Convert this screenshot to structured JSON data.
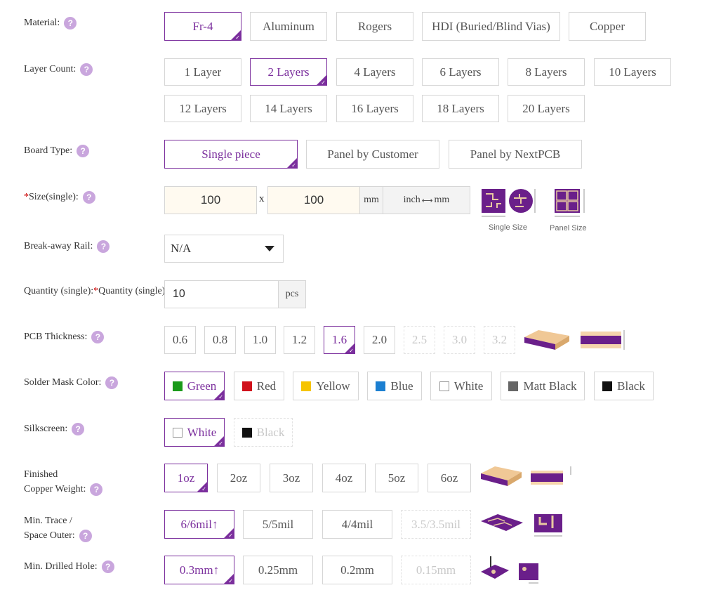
{
  "material": {
    "label": "Material:",
    "options": [
      "Fr-4",
      "Aluminum",
      "Rogers",
      "HDI (Buried/Blind Vias)",
      "Copper"
    ]
  },
  "layer_count": {
    "label": "Layer Count:",
    "options": [
      "1 Layer",
      "2 Layers",
      "4 Layers",
      "6 Layers",
      "8 Layers",
      "10 Layers",
      "12 Layers",
      "14 Layers",
      "16 Layers",
      "18 Layers",
      "20 Layers"
    ]
  },
  "board_type": {
    "label": "Board Type:",
    "options": [
      "Single piece",
      "Panel by Customer",
      "Panel by NextPCB"
    ]
  },
  "size": {
    "label": "*Size(single):",
    "width": "100",
    "height": "100",
    "x": "x",
    "unit": "mm",
    "toggle_left": "inch",
    "toggle_right": "mm",
    "single_caption": "Single Size",
    "panel_caption": "Panel Size"
  },
  "breakaway": {
    "label": "Break-away Rail:",
    "value": "N/A"
  },
  "quantity": {
    "label": "*Quantity (single):",
    "value": "10",
    "unit": "pcs"
  },
  "thickness": {
    "label": "PCB Thickness:",
    "options": [
      "0.6",
      "0.8",
      "1.0",
      "1.2",
      "1.6",
      "2.0",
      "2.5",
      "3.0",
      "3.2"
    ]
  },
  "solder_mask": {
    "label": "Solder Mask Color:",
    "options": [
      "Green",
      "Red",
      "Yellow",
      "Blue",
      "White",
      "Matt Black",
      "Black"
    ],
    "colors": [
      "#1a9a1a",
      "#d0111b",
      "#f6c400",
      "#1b7fd1",
      "#ffffff",
      "#666666",
      "#111111"
    ]
  },
  "silkscreen": {
    "label": "Silkscreen:",
    "options": [
      "White",
      "Black"
    ]
  },
  "copper_weight": {
    "label_line1": "Finished",
    "label_line2": "Copper Weight:",
    "options": [
      "1oz",
      "2oz",
      "3oz",
      "4oz",
      "5oz",
      "6oz"
    ]
  },
  "trace": {
    "label_line1": "Min. Trace /",
    "label_line2": "Space Outer:",
    "options": [
      "6/6mil↑",
      "5/5mil",
      "4/4mil",
      "3.5/3.5mil"
    ]
  },
  "drill": {
    "label": "Min. Drilled Hole:",
    "options": [
      "0.3mm↑",
      "0.25mm",
      "0.2mm",
      "0.15mm"
    ]
  },
  "help_icon": "?"
}
